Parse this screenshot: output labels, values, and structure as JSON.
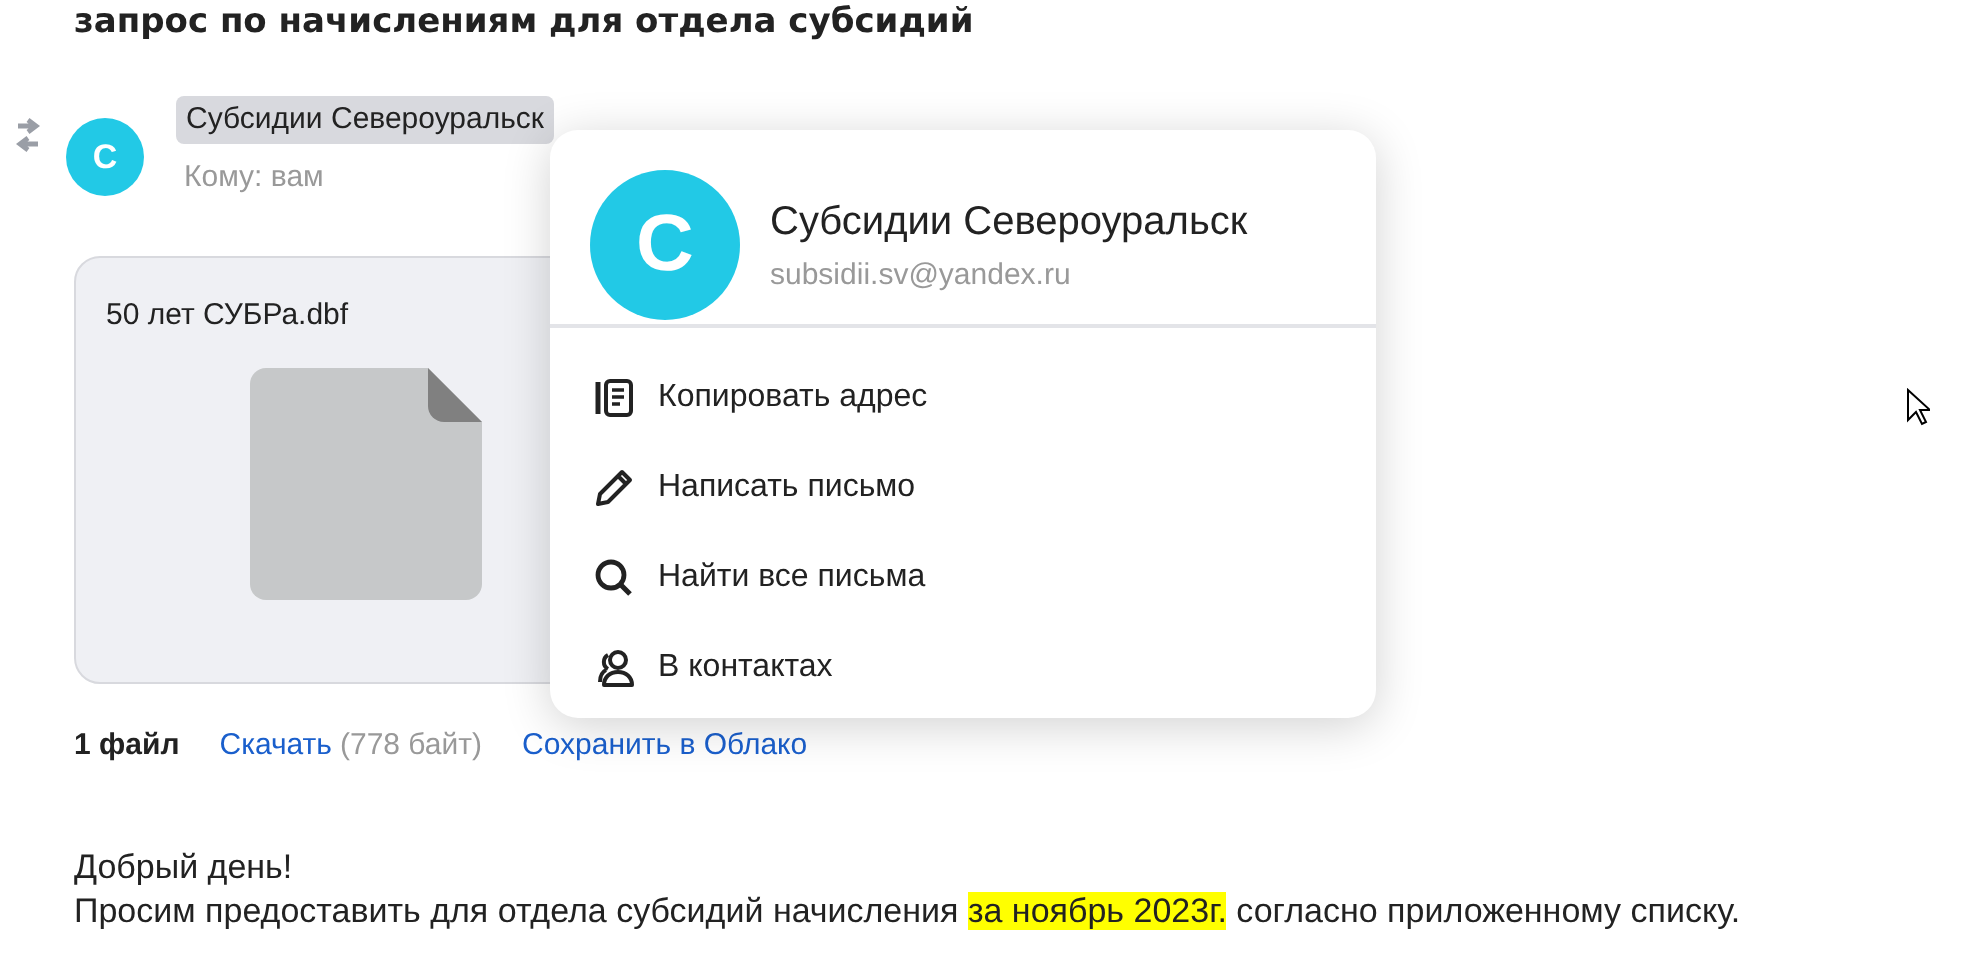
{
  "subject": "запрос по начислениям для отдела субсидий",
  "message": {
    "sender": "Субсидии Североуральск",
    "avatar_letter": "С",
    "recipient": "Кому: вам"
  },
  "attachment": {
    "file_name": "50 лет СУБРа.dbf",
    "count": "1 файл",
    "download": "Скачать",
    "size": "(778 байт)",
    "save": "Сохранить в Облако"
  },
  "contact_popup": {
    "avatar_letter": "С",
    "name": "Субсидии Североуральск",
    "email": "subsidii.sv@yandex.ru",
    "actions": [
      {
        "kind": "copy",
        "label": "Копировать адрес"
      },
      {
        "kind": "compose",
        "label": "Написать письмо"
      },
      {
        "kind": "search",
        "label": "Найти все письма"
      },
      {
        "kind": "contacts",
        "label": "В контактах"
      }
    ]
  },
  "body": [
    {
      "segments": [
        {
          "text": "Добрый день!",
          "highlighted": false
        }
      ]
    },
    {
      "segments": [
        {
          "text": "Просим предоставить для отдела субсидий начисления ",
          "highlighted": false
        },
        {
          "text": "за ноябрь 2023г.",
          "highlighted": true
        },
        {
          "text": " согласно приложенному списку.",
          "highlighted": false
        }
      ]
    }
  ]
}
